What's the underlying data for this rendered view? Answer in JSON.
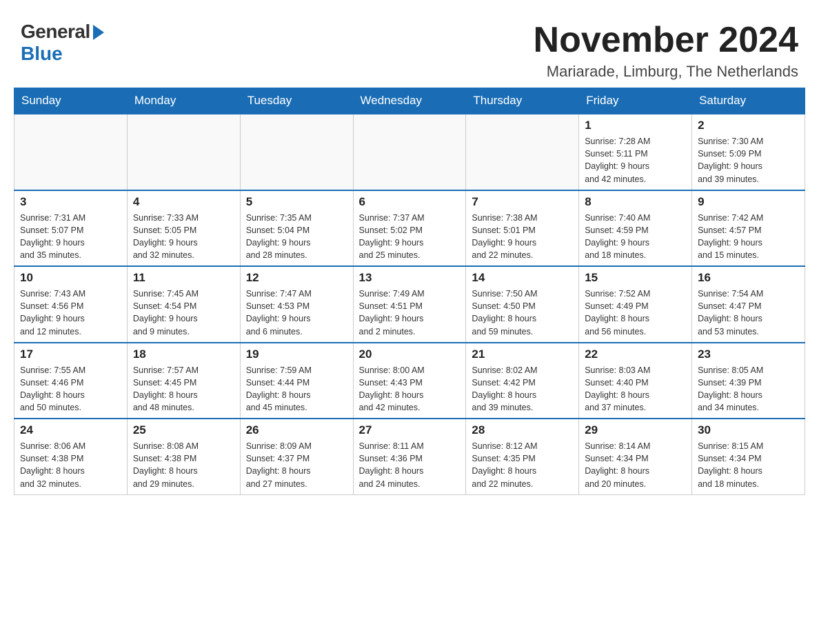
{
  "header": {
    "logo_general": "General",
    "logo_blue": "Blue",
    "month_title": "November 2024",
    "location": "Mariarade, Limburg, The Netherlands"
  },
  "days_of_week": [
    "Sunday",
    "Monday",
    "Tuesday",
    "Wednesday",
    "Thursday",
    "Friday",
    "Saturday"
  ],
  "weeks": [
    [
      {
        "day": "",
        "info": ""
      },
      {
        "day": "",
        "info": ""
      },
      {
        "day": "",
        "info": ""
      },
      {
        "day": "",
        "info": ""
      },
      {
        "day": "",
        "info": ""
      },
      {
        "day": "1",
        "info": "Sunrise: 7:28 AM\nSunset: 5:11 PM\nDaylight: 9 hours\nand 42 minutes."
      },
      {
        "day": "2",
        "info": "Sunrise: 7:30 AM\nSunset: 5:09 PM\nDaylight: 9 hours\nand 39 minutes."
      }
    ],
    [
      {
        "day": "3",
        "info": "Sunrise: 7:31 AM\nSunset: 5:07 PM\nDaylight: 9 hours\nand 35 minutes."
      },
      {
        "day": "4",
        "info": "Sunrise: 7:33 AM\nSunset: 5:05 PM\nDaylight: 9 hours\nand 32 minutes."
      },
      {
        "day": "5",
        "info": "Sunrise: 7:35 AM\nSunset: 5:04 PM\nDaylight: 9 hours\nand 28 minutes."
      },
      {
        "day": "6",
        "info": "Sunrise: 7:37 AM\nSunset: 5:02 PM\nDaylight: 9 hours\nand 25 minutes."
      },
      {
        "day": "7",
        "info": "Sunrise: 7:38 AM\nSunset: 5:01 PM\nDaylight: 9 hours\nand 22 minutes."
      },
      {
        "day": "8",
        "info": "Sunrise: 7:40 AM\nSunset: 4:59 PM\nDaylight: 9 hours\nand 18 minutes."
      },
      {
        "day": "9",
        "info": "Sunrise: 7:42 AM\nSunset: 4:57 PM\nDaylight: 9 hours\nand 15 minutes."
      }
    ],
    [
      {
        "day": "10",
        "info": "Sunrise: 7:43 AM\nSunset: 4:56 PM\nDaylight: 9 hours\nand 12 minutes."
      },
      {
        "day": "11",
        "info": "Sunrise: 7:45 AM\nSunset: 4:54 PM\nDaylight: 9 hours\nand 9 minutes."
      },
      {
        "day": "12",
        "info": "Sunrise: 7:47 AM\nSunset: 4:53 PM\nDaylight: 9 hours\nand 6 minutes."
      },
      {
        "day": "13",
        "info": "Sunrise: 7:49 AM\nSunset: 4:51 PM\nDaylight: 9 hours\nand 2 minutes."
      },
      {
        "day": "14",
        "info": "Sunrise: 7:50 AM\nSunset: 4:50 PM\nDaylight: 8 hours\nand 59 minutes."
      },
      {
        "day": "15",
        "info": "Sunrise: 7:52 AM\nSunset: 4:49 PM\nDaylight: 8 hours\nand 56 minutes."
      },
      {
        "day": "16",
        "info": "Sunrise: 7:54 AM\nSunset: 4:47 PM\nDaylight: 8 hours\nand 53 minutes."
      }
    ],
    [
      {
        "day": "17",
        "info": "Sunrise: 7:55 AM\nSunset: 4:46 PM\nDaylight: 8 hours\nand 50 minutes."
      },
      {
        "day": "18",
        "info": "Sunrise: 7:57 AM\nSunset: 4:45 PM\nDaylight: 8 hours\nand 48 minutes."
      },
      {
        "day": "19",
        "info": "Sunrise: 7:59 AM\nSunset: 4:44 PM\nDaylight: 8 hours\nand 45 minutes."
      },
      {
        "day": "20",
        "info": "Sunrise: 8:00 AM\nSunset: 4:43 PM\nDaylight: 8 hours\nand 42 minutes."
      },
      {
        "day": "21",
        "info": "Sunrise: 8:02 AM\nSunset: 4:42 PM\nDaylight: 8 hours\nand 39 minutes."
      },
      {
        "day": "22",
        "info": "Sunrise: 8:03 AM\nSunset: 4:40 PM\nDaylight: 8 hours\nand 37 minutes."
      },
      {
        "day": "23",
        "info": "Sunrise: 8:05 AM\nSunset: 4:39 PM\nDaylight: 8 hours\nand 34 minutes."
      }
    ],
    [
      {
        "day": "24",
        "info": "Sunrise: 8:06 AM\nSunset: 4:38 PM\nDaylight: 8 hours\nand 32 minutes."
      },
      {
        "day": "25",
        "info": "Sunrise: 8:08 AM\nSunset: 4:38 PM\nDaylight: 8 hours\nand 29 minutes."
      },
      {
        "day": "26",
        "info": "Sunrise: 8:09 AM\nSunset: 4:37 PM\nDaylight: 8 hours\nand 27 minutes."
      },
      {
        "day": "27",
        "info": "Sunrise: 8:11 AM\nSunset: 4:36 PM\nDaylight: 8 hours\nand 24 minutes."
      },
      {
        "day": "28",
        "info": "Sunrise: 8:12 AM\nSunset: 4:35 PM\nDaylight: 8 hours\nand 22 minutes."
      },
      {
        "day": "29",
        "info": "Sunrise: 8:14 AM\nSunset: 4:34 PM\nDaylight: 8 hours\nand 20 minutes."
      },
      {
        "day": "30",
        "info": "Sunrise: 8:15 AM\nSunset: 4:34 PM\nDaylight: 8 hours\nand 18 minutes."
      }
    ]
  ]
}
